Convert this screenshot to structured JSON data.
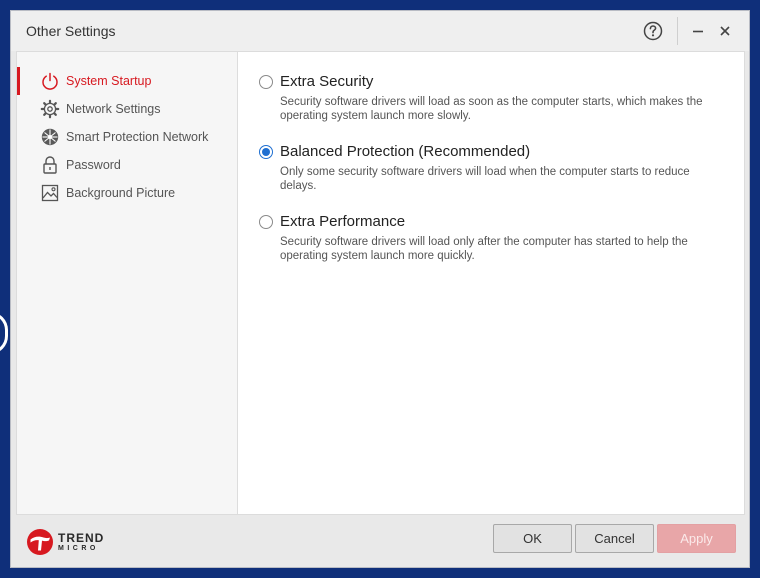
{
  "window": {
    "title": "Other Settings",
    "help_icon": "question-circle-icon",
    "minimize_icon": "minimize-icon",
    "close_icon": "close-icon"
  },
  "sidebar": {
    "items": [
      {
        "label": "System Startup",
        "icon": "power-icon",
        "active": true
      },
      {
        "label": "Network Settings",
        "icon": "gear-icon",
        "active": false
      },
      {
        "label": "Smart Protection Network",
        "icon": "globe-network-icon",
        "active": false
      },
      {
        "label": "Password",
        "icon": "lock-icon",
        "active": false
      },
      {
        "label": "Background Picture",
        "icon": "picture-icon",
        "active": false
      }
    ]
  },
  "main": {
    "options": [
      {
        "title": "Extra Security",
        "description": "Security software drivers will load as soon as the computer starts, which makes the operating system launch more slowly.",
        "selected": false
      },
      {
        "title": "Balanced Protection (Recommended)",
        "description": "Only some security software drivers will load when the computer starts to reduce delays.",
        "selected": true
      },
      {
        "title": "Extra Performance",
        "description": "Security software drivers will load only after the computer has started to help the operating system launch more quickly.",
        "selected": false
      }
    ]
  },
  "footer": {
    "logo_line1": "TREND",
    "logo_line2": "MICRO",
    "ok_label": "OK",
    "cancel_label": "Cancel",
    "apply_label": "Apply"
  },
  "colors": {
    "accent": "#d71920",
    "radio_selected": "#1f6fd1",
    "desktop": "#0f2f7a",
    "apply_disabled": "#e8a6a8"
  }
}
